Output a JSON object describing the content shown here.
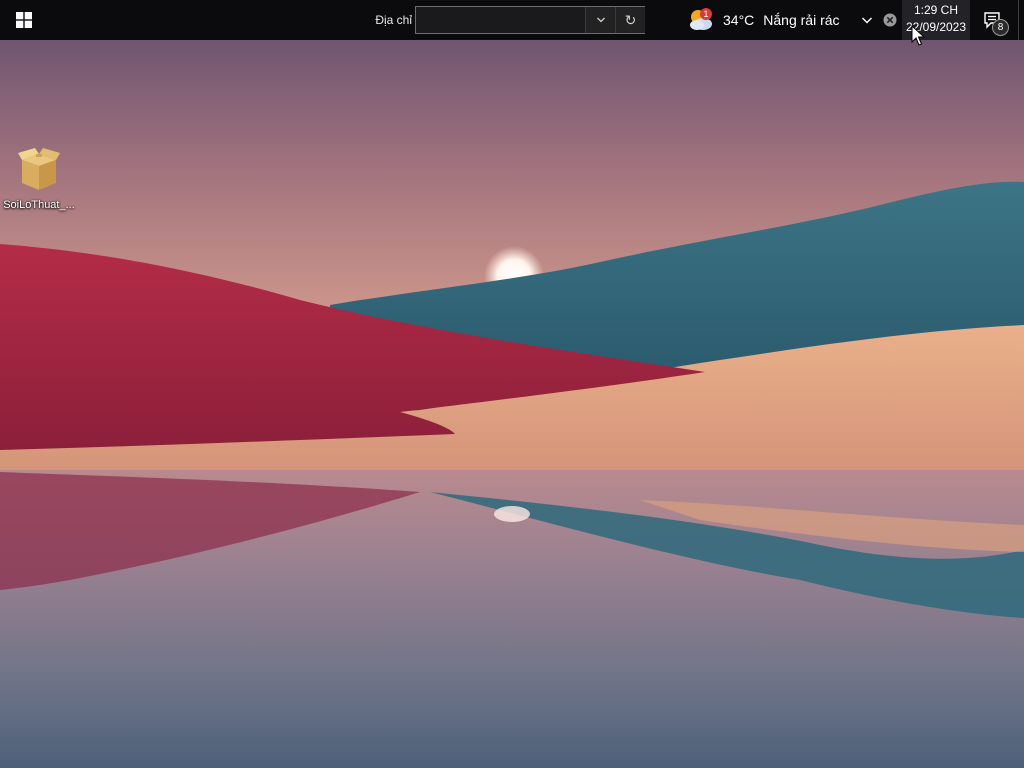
{
  "taskbar": {
    "start_icon": "windows-logo-icon",
    "address": {
      "label": "Địa chỉ",
      "value": "",
      "dropdown_icon": "chevron-down-icon",
      "refresh_icon": "refresh-icon",
      "refresh_glyph": "↻"
    },
    "weather": {
      "icon": "partly-sunny-icon",
      "badge": "1",
      "temperature": "34°C",
      "description": "Nắng rải rác"
    },
    "tray": {
      "chevron_icon": "chevron-down-icon",
      "close_icon": "close-circle-icon"
    },
    "clock": {
      "time": "1:29 CH",
      "date": "22/09/2023"
    },
    "notifications": {
      "icon": "notification-center-icon",
      "count": "8"
    }
  },
  "desktop": {
    "icons": [
      {
        "label": "SoiLoThuat_...",
        "icon": "package-box-icon"
      }
    ],
    "wallpaper": "sunset-hills-lake"
  },
  "colors": {
    "taskbar": "#0b0b0d",
    "sky_top": "#6e5873",
    "red_hill": "#a3243e",
    "teal_hill": "#2f6a7d",
    "sand": "#e0a67f",
    "badge": "#d83b3b"
  }
}
